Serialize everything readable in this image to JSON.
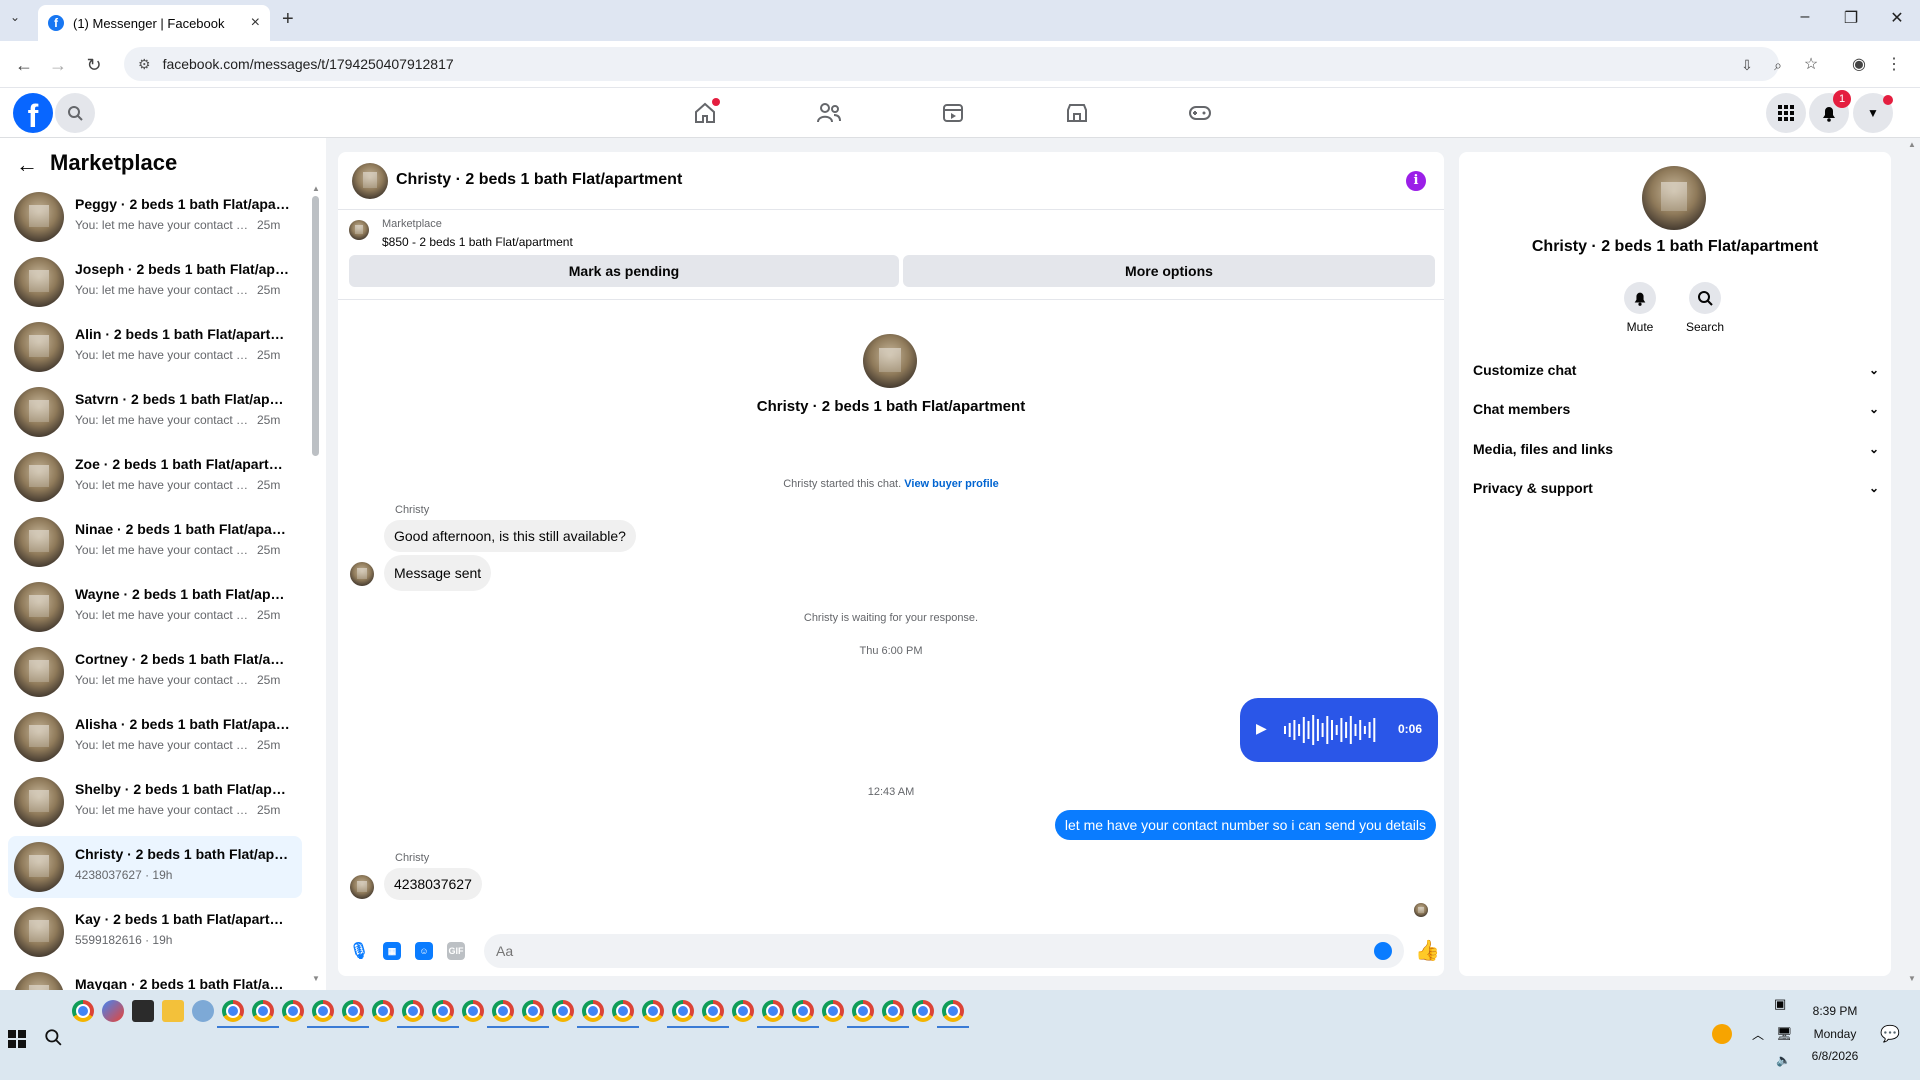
{
  "browser": {
    "tab_title": "(1) Messenger | Facebook",
    "url": "facebook.com/messages/t/1794250407912817"
  },
  "sidebar": {
    "title": "Marketplace",
    "conversations": [
      {
        "name": "Peggy · 2 beds 1 bath Flat/apart...",
        "snippet": "You: let me have your contact nu...",
        "time": "25m"
      },
      {
        "name": "Joseph · 2 beds 1 bath Flat/apar...",
        "snippet": "You: let me have your contact nu...",
        "time": "25m"
      },
      {
        "name": "Alin · 2 beds 1 bath Flat/apartm...",
        "snippet": "You: let me have your contact nu...",
        "time": "25m"
      },
      {
        "name": "Satvrn · 2 beds 1 bath Flat/apart...",
        "snippet": "You: let me have your contact nu...",
        "time": "25m"
      },
      {
        "name": "Zoe · 2 beds 1 bath Flat/apartm...",
        "snippet": "You: let me have your contact nu...",
        "time": "25m"
      },
      {
        "name": "Ninae · 2 beds 1 bath Flat/apart...",
        "snippet": "You: let me have your contact nu...",
        "time": "25m"
      },
      {
        "name": "Wayne · 2 beds 1 bath Flat/apart...",
        "snippet": "You: let me have your contact nu...",
        "time": "25m"
      },
      {
        "name": "Cortney · 2 beds 1 bath Flat/apa...",
        "snippet": "You: let me have your contact nu...",
        "time": "25m"
      },
      {
        "name": "Alisha · 2 beds 1 bath Flat/apart...",
        "snippet": "You: let me have your contact nu...",
        "time": "25m"
      },
      {
        "name": "Shelby · 2 beds 1 bath Flat/apart...",
        "snippet": "You: let me have your contact nu...",
        "time": "25m"
      },
      {
        "name": "Christy · 2 beds 1 bath Flat/apar...",
        "snippet": "4238037627 · 19h",
        "time": ""
      },
      {
        "name": "Kay · 2 beds 1 bath Flat/apartme...",
        "snippet": "5599182616 · 19h",
        "time": ""
      },
      {
        "name": "Maygan · 2 beds 1 bath Flat/apa...",
        "snippet": "",
        "time": ""
      }
    ]
  },
  "chat": {
    "title": "Christy · 2 beds 1 bath Flat/apartment",
    "listing_label": "Marketplace",
    "listing_detail": "$850 - 2 beds 1 bath Flat/apartment",
    "mark_pending": "Mark as pending",
    "more_options": "More options",
    "intro_name": "Christy · 2 beds 1 bath Flat/apartment",
    "started_text": "Christy started this chat.",
    "view_profile": "View buyer profile",
    "sender1": "Christy",
    "msg1": "Good afternoon, is this still available?",
    "msg2": "Message sent",
    "waiting": "Christy is waiting for your response.",
    "time1": "Thu 6:00 PM",
    "voice_duration": "0:06",
    "time2": "12:43 AM",
    "msg_me": "let me have your contact number so i can send you details",
    "sender2": "Christy",
    "msg3": "4238037627",
    "composer_placeholder": "Aa",
    "gif_label": "GIF"
  },
  "details": {
    "name": "Christy · 2 beds 1 bath Flat/apartment",
    "mute": "Mute",
    "search": "Search",
    "sections": [
      "Customize chat",
      "Chat members",
      "Media, files and links",
      "Privacy & support"
    ]
  },
  "header": {
    "notification_count": "1"
  },
  "taskbar": {
    "time": "8:39 PM",
    "day": "Monday",
    "date": "6/8/2026"
  },
  "colors": {
    "brand": "#0866ff",
    "bubble_me": "#0a7cff",
    "info": "#9b1fe8"
  }
}
